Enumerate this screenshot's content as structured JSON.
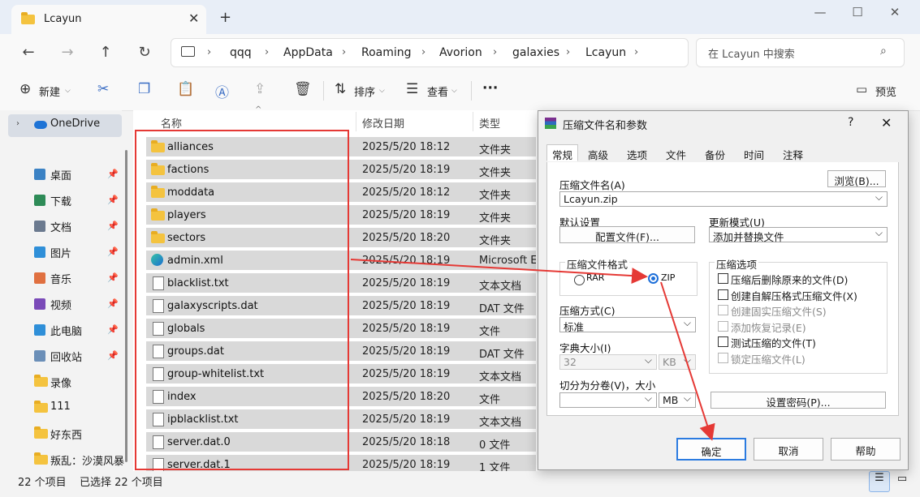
{
  "tab": {
    "title": "Lcayun",
    "close": "✕",
    "new": "+"
  },
  "window": {
    "minimize": "—",
    "maximize": "☐",
    "close": "✕"
  },
  "nav": {
    "back": "←",
    "forward": "→",
    "up": "↑",
    "refresh": "↻"
  },
  "breadcrumb": [
    "qqq",
    "AppData",
    "Roaming",
    "Avorion",
    "galaxies",
    "Lcayun"
  ],
  "search": {
    "placeholder": "在 Lcayun 中搜索"
  },
  "toolbar": {
    "new": "新建",
    "sort": "排序",
    "view": "查看",
    "more": "···",
    "preview": "预览"
  },
  "sidebar": {
    "onedrive": "OneDrive",
    "items": [
      {
        "label": "桌面",
        "icon": "desktop-icon",
        "color": "#3b82c4",
        "pinned": true
      },
      {
        "label": "下载",
        "icon": "download-icon",
        "color": "#2e8b57",
        "pinned": true
      },
      {
        "label": "文档",
        "icon": "document-icon",
        "color": "#6b7a8f",
        "pinned": true
      },
      {
        "label": "图片",
        "icon": "picture-icon",
        "color": "#2f8fd8",
        "pinned": true
      },
      {
        "label": "音乐",
        "icon": "music-icon",
        "color": "#e07040",
        "pinned": true
      },
      {
        "label": "视频",
        "icon": "video-icon",
        "color": "#7a4ab8",
        "pinned": true
      },
      {
        "label": "此电脑",
        "icon": "computer-icon",
        "color": "#2f8fd8",
        "pinned": true
      },
      {
        "label": "回收站",
        "icon": "recycle-bin-icon",
        "color": "#6b8fb8",
        "pinned": true
      },
      {
        "label": "录像",
        "icon": "folder-icon",
        "color": "#f4c33f",
        "pinned": false
      },
      {
        "label": "111",
        "icon": "folder-icon",
        "color": "#f4c33f",
        "pinned": false
      },
      {
        "label": "好东西",
        "icon": "folder-icon",
        "color": "#f4c33f",
        "pinned": false
      },
      {
        "label": "叛乱：沙漠风暴",
        "icon": "folder-icon",
        "color": "#f4c33f",
        "pinned": false
      }
    ]
  },
  "columns": {
    "name": "名称",
    "date": "修改日期",
    "type": "类型"
  },
  "files": [
    {
      "name": "alliances",
      "date": "2025/5/20 18:12",
      "type": "文件夹",
      "kind": "folder"
    },
    {
      "name": "factions",
      "date": "2025/5/20 18:19",
      "type": "文件夹",
      "kind": "folder"
    },
    {
      "name": "moddata",
      "date": "2025/5/20 18:12",
      "type": "文件夹",
      "kind": "folder"
    },
    {
      "name": "players",
      "date": "2025/5/20 18:19",
      "type": "文件夹",
      "kind": "folder"
    },
    {
      "name": "sectors",
      "date": "2025/5/20 18:20",
      "type": "文件夹",
      "kind": "folder"
    },
    {
      "name": "admin.xml",
      "date": "2025/5/20 18:19",
      "type": "Microsoft Ed",
      "kind": "edge"
    },
    {
      "name": "blacklist.txt",
      "date": "2025/5/20 18:19",
      "type": "文本文档",
      "kind": "doc"
    },
    {
      "name": "galaxyscripts.dat",
      "date": "2025/5/20 18:19",
      "type": "DAT 文件",
      "kind": "doc"
    },
    {
      "name": "globals",
      "date": "2025/5/20 18:19",
      "type": "文件",
      "kind": "doc"
    },
    {
      "name": "groups.dat",
      "date": "2025/5/20 18:19",
      "type": "DAT 文件",
      "kind": "doc"
    },
    {
      "name": "group-whitelist.txt",
      "date": "2025/5/20 18:19",
      "type": "文本文档",
      "kind": "doc"
    },
    {
      "name": "index",
      "date": "2025/5/20 18:20",
      "type": "文件",
      "kind": "doc"
    },
    {
      "name": "ipblacklist.txt",
      "date": "2025/5/20 18:19",
      "type": "文本文档",
      "kind": "doc"
    },
    {
      "name": "server.dat.0",
      "date": "2025/5/20 18:18",
      "type": "0 文件",
      "kind": "doc"
    },
    {
      "name": "server.dat.1",
      "date": "2025/5/20 18:19",
      "type": "1 文件",
      "kind": "doc"
    }
  ],
  "status": {
    "count": "22 个项目",
    "selected": "已选择 22 个项目"
  },
  "dialog": {
    "title": "压缩文件名和参数",
    "help": "?",
    "close": "✕",
    "tabs": [
      "常规",
      "高级",
      "选项",
      "文件",
      "备份",
      "时间",
      "注释"
    ],
    "archive_name_label": "压缩文件名(A)",
    "archive_name": "Lcayun.zip",
    "browse": "浏览(B)...",
    "default_settings_label": "默认设置",
    "profiles_btn": "配置文件(F)...",
    "update_mode_label": "更新模式(U)",
    "update_mode": "添加并替换文件",
    "format_label": "压缩文件格式",
    "format_rar": "RAR",
    "format_zip": "ZIP",
    "method_label": "压缩方式(C)",
    "method": "标准",
    "dict_label": "字典大小(I)",
    "dict_value": "32",
    "dict_unit": "KB",
    "split_label": "切分为分卷(V)，大小",
    "split_unit": "MB",
    "options_label": "压缩选项",
    "options": [
      {
        "label": "压缩后删除原来的文件(D)",
        "disabled": false
      },
      {
        "label": "创建自解压格式压缩文件(X)",
        "disabled": false
      },
      {
        "label": "创建固实压缩文件(S)",
        "disabled": true
      },
      {
        "label": "添加恢复记录(E)",
        "disabled": true
      },
      {
        "label": "测试压缩的文件(T)",
        "disabled": false
      },
      {
        "label": "锁定压缩文件(L)",
        "disabled": true
      }
    ],
    "password_btn": "设置密码(P)...",
    "ok": "确定",
    "cancel": "取消",
    "helpbtn": "帮助"
  },
  "annotation_color": "#e53935"
}
